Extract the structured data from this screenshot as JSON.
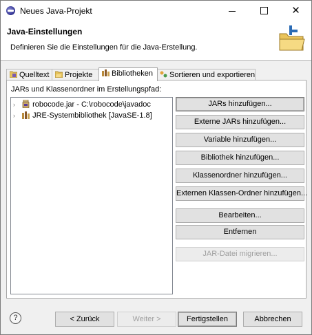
{
  "window": {
    "title": "Neues Java-Projekt",
    "minimize": "",
    "maximize": "",
    "close": "✕"
  },
  "banner": {
    "title": "Java-Einstellungen",
    "description": "Definieren Sie die Einstellungen für die Java-Erstellung."
  },
  "tabs": [
    {
      "label": "Quelltext",
      "icon": "source-folder-icon",
      "active": false
    },
    {
      "label": "Projekte",
      "icon": "projects-icon",
      "active": false
    },
    {
      "label": "Bibliotheken",
      "icon": "libraries-icon",
      "active": true
    },
    {
      "label": "Sortieren und exportieren",
      "icon": "order-export-icon",
      "active": false
    }
  ],
  "build_path": {
    "label": "JARs und Klassenordner im Erstellungspfad:",
    "entries": [
      {
        "label": "robocode.jar - C:\\robocode\\javadoc",
        "icon": "jar-icon",
        "expander": "›"
      },
      {
        "label": "JRE-Systembibliothek [JavaSE-1.8]",
        "icon": "library-icon",
        "expander": "›"
      }
    ]
  },
  "side_buttons": {
    "add_jars": "JARs hinzufügen...",
    "add_external_jars": "Externe JARs hinzufügen...",
    "add_variable": "Variable hinzufügen...",
    "add_library": "Bibliothek hinzufügen...",
    "add_class_folder": "Klassenordner hinzufügen...",
    "add_external_class_folder": "Externen Klassen-Ordner hinzufügen...",
    "edit": "Bearbeiten...",
    "remove": "Entfernen",
    "migrate_jar": "JAR-Datei migrieren..."
  },
  "footer": {
    "help": "?",
    "back": "< Zurück",
    "next": "Weiter >",
    "finish": "Fertigstellen",
    "cancel": "Abbrechen"
  },
  "colors": {
    "accent": "#0078d7",
    "dialog_bg": "#f0f0f0",
    "button_bg": "#e1e1e1"
  }
}
